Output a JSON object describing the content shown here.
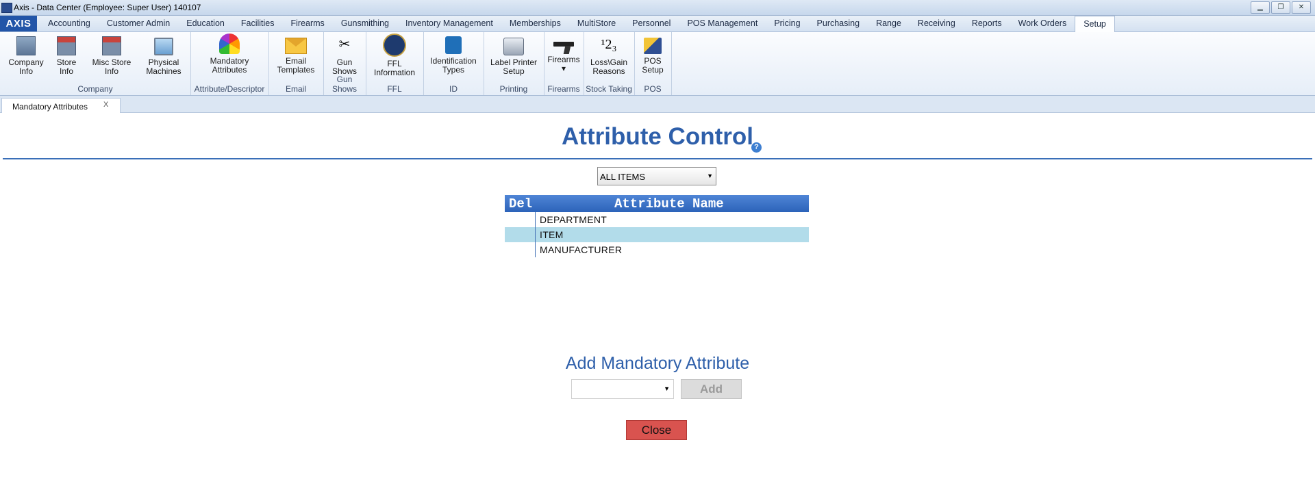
{
  "window": {
    "title": "Axis - Data Center  (Employee: Super User) 140107"
  },
  "menu": {
    "logo": "AXIS",
    "tabs": [
      "Accounting",
      "Customer Admin",
      "Education",
      "Facilities",
      "Firearms",
      "Gunsmithing",
      "Inventory Management",
      "Memberships",
      "MultiStore",
      "Personnel",
      "POS Management",
      "Pricing",
      "Purchasing",
      "Range",
      "Receiving",
      "Reports",
      "Work Orders",
      "Setup"
    ],
    "active_tab": "Setup"
  },
  "ribbon": {
    "groups": [
      {
        "name": "Company",
        "buttons": [
          {
            "line1": "Company",
            "line2": "Info",
            "icon": "building-icon"
          },
          {
            "line1": "Store",
            "line2": "Info",
            "icon": "store-icon"
          },
          {
            "line1": "Misc Store",
            "line2": "Info",
            "icon": "store-icon"
          },
          {
            "line1": "Physical",
            "line2": "Machines",
            "icon": "monitor-icon"
          }
        ]
      },
      {
        "name": "Attribute/Descriptor",
        "buttons": [
          {
            "line1": "Mandatory",
            "line2": "Attributes",
            "icon": "color-fan-icon"
          }
        ]
      },
      {
        "name": "Email",
        "buttons": [
          {
            "line1": "Email",
            "line2": "Templates",
            "icon": "envelope-icon"
          }
        ]
      },
      {
        "name": "Gun Shows",
        "buttons": [
          {
            "line1": "Gun",
            "line2": "Shows",
            "icon": "crossed-guns-icon"
          }
        ]
      },
      {
        "name": "FFL",
        "buttons": [
          {
            "line1": "FFL",
            "line2": "Information",
            "icon": "seal-icon"
          }
        ]
      },
      {
        "name": "ID",
        "buttons": [
          {
            "line1": "Identification",
            "line2": "Types",
            "icon": "id-badge-icon"
          }
        ]
      },
      {
        "name": "Printing",
        "buttons": [
          {
            "line1": "Label Printer",
            "line2": "Setup",
            "icon": "printer-icon"
          }
        ]
      },
      {
        "name": "Firearms",
        "buttons": [
          {
            "line1": "Firearms",
            "line2": "▾",
            "icon": "pistol-icon"
          }
        ]
      },
      {
        "name": "Stock Taking",
        "buttons": [
          {
            "line1": "Loss\\Gain",
            "line2": "Reasons",
            "icon": "numbers-icon",
            "glyph": "¹2₃"
          }
        ]
      },
      {
        "name": "POS",
        "buttons": [
          {
            "line1": "POS",
            "line2": "Setup",
            "icon": "pos-icon"
          }
        ]
      }
    ]
  },
  "doc_tab": {
    "label": "Mandatory Attributes",
    "close": "X"
  },
  "main": {
    "title": "Attribute Control",
    "help": "?",
    "filter": {
      "selected": "ALL ITEMS"
    },
    "grid": {
      "headers": {
        "del": "Del",
        "name": "Attribute Name"
      },
      "rows": [
        {
          "name": "DEPARTMENT",
          "selected": false
        },
        {
          "name": "ITEM",
          "selected": true
        },
        {
          "name": "MANUFACTURER",
          "selected": false
        }
      ]
    },
    "add_title": "Add Mandatory Attribute",
    "add_select": {
      "selected": ""
    },
    "add_button": "Add",
    "close_button": "Close"
  },
  "colors": {
    "accent": "#2e5faa",
    "header": "#2c63b9",
    "selected_row": "#b2dcea",
    "close": "#d9534f"
  }
}
